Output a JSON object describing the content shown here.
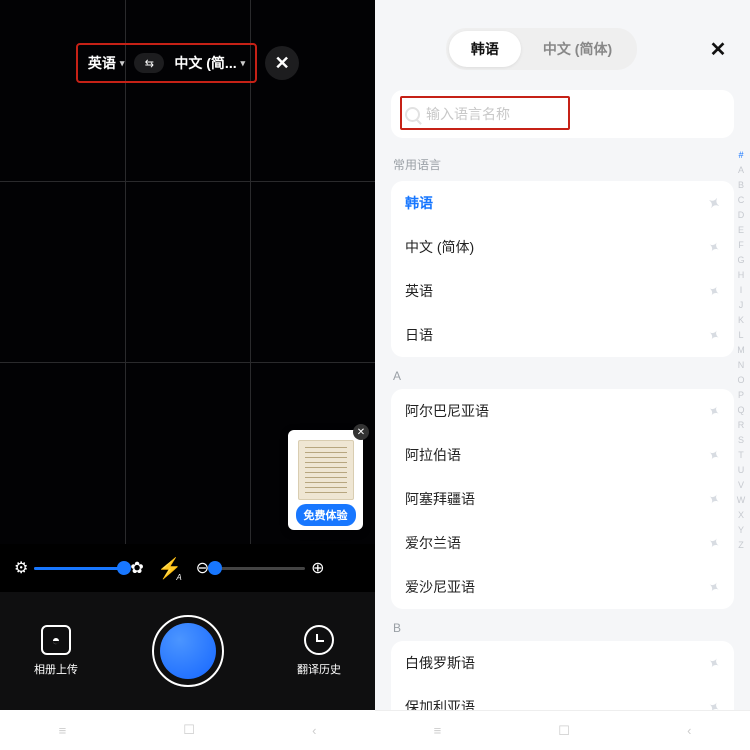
{
  "left": {
    "lang_from": "英语",
    "lang_to": "中文 (简...",
    "swap_glyph": "⇆",
    "close_glyph": "✕",
    "preview_badge": "免费体验",
    "preview_close": "✕",
    "brightness": {
      "fill_pct": 100,
      "thumb_pct": 100,
      "icon_left": "⚙",
      "icon_right": "✿"
    },
    "zoom": {
      "fill_pct": 0,
      "thumb_pct": 0,
      "icon_out": "⊖",
      "icon_in": "⊕"
    },
    "flash_glyph": "⚡",
    "flash_mode": "A",
    "bottom": {
      "gallery_label": "相册上传",
      "history_label": "翻译历史"
    },
    "nav": {
      "menu": "≡",
      "home": "☐",
      "back": "‹"
    }
  },
  "right": {
    "tabs": {
      "active": "韩语",
      "inactive": "中文 (简体)"
    },
    "close_glyph": "✕",
    "search_placeholder": "输入语言名称",
    "section_common": "常用语言",
    "common": [
      {
        "label": "韩语",
        "selected": true
      },
      {
        "label": "中文 (简体)",
        "selected": false
      },
      {
        "label": "英语",
        "selected": false
      },
      {
        "label": "日语",
        "selected": false
      }
    ],
    "letter_a": "A",
    "group_a": [
      {
        "label": "阿尔巴尼亚语"
      },
      {
        "label": "阿拉伯语"
      },
      {
        "label": "阿塞拜疆语"
      },
      {
        "label": "爱尔兰语"
      },
      {
        "label": "爱沙尼亚语"
      }
    ],
    "letter_b": "B",
    "group_b": [
      {
        "label": "白俄罗斯语"
      },
      {
        "label": "保加利亚语"
      }
    ],
    "pin_glyph": "✦",
    "index": [
      "#",
      "A",
      "B",
      "C",
      "D",
      "E",
      "F",
      "G",
      "H",
      "I",
      "J",
      "K",
      "L",
      "M",
      "N",
      "O",
      "P",
      "Q",
      "R",
      "S",
      "T",
      "U",
      "V",
      "W",
      "X",
      "Y",
      "Z"
    ],
    "nav": {
      "menu": "≡",
      "home": "☐",
      "back": "‹"
    }
  }
}
